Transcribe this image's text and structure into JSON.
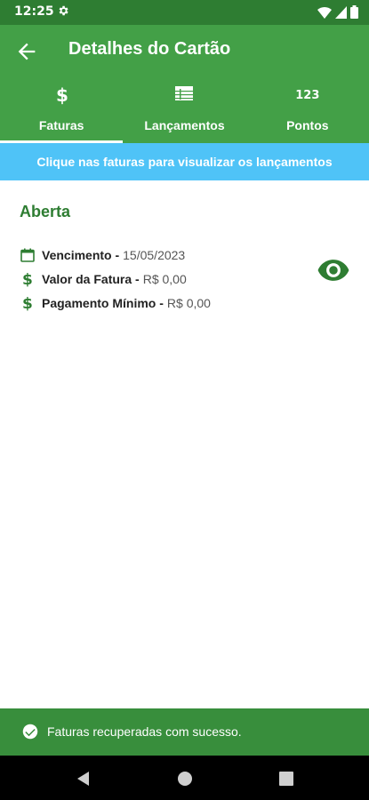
{
  "status_bar": {
    "time": "12:25"
  },
  "app_bar": {
    "title": "Detalhes do Cartão"
  },
  "tabs": [
    {
      "label": "Faturas",
      "icon": "dollar-icon",
      "active": true
    },
    {
      "label": "Lançamentos",
      "icon": "list-icon",
      "active": false
    },
    {
      "label": "Pontos",
      "icon": "numbers-icon",
      "active": false
    },
    {
      "icon_text": "123"
    }
  ],
  "banner": {
    "text": "Clique nas faturas para visualizar os lançamentos"
  },
  "section": {
    "title": "Aberta"
  },
  "invoice": {
    "due_label": "Vencimento -",
    "due_value": "15/05/2023",
    "amount_label": "Valor da Fatura -",
    "amount_value": "R$ 0,00",
    "min_label": "Pagamento Mínimo -",
    "min_value": "R$ 0,00"
  },
  "snackbar": {
    "message": "Faturas recuperadas com sucesso."
  },
  "colors": {
    "primary": "#43a047",
    "dark": "#2e7d32",
    "banner": "#4fc3f7"
  }
}
